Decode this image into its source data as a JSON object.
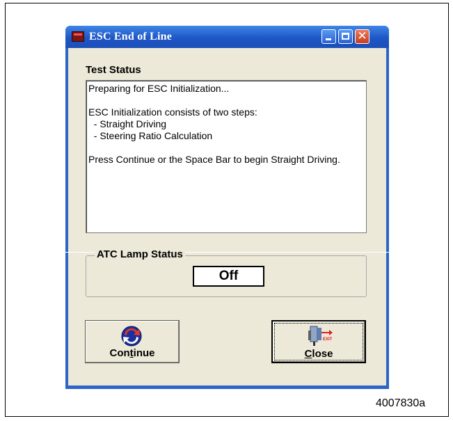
{
  "window": {
    "title": "ESC End of Line",
    "controls": [
      "minimize",
      "maximize",
      "close"
    ],
    "close_glyph": "✕"
  },
  "test_status": {
    "label": "Test Status",
    "lines": [
      "Preparing for ESC Initialization...",
      "",
      "ESC Initialization consists of two steps:",
      "  - Straight Driving",
      "  - Steering Ratio Calculation",
      "",
      "Press Continue or the Space Bar to begin Straight Driving."
    ]
  },
  "atc_lamp": {
    "label": "ATC Lamp Status",
    "value": "Off"
  },
  "buttons": {
    "continue": {
      "label_pre": "Con",
      "label_ul": "t",
      "label_post": "inue",
      "icon": "refresh-icon"
    },
    "close": {
      "label_pre": "",
      "label_ul": "C",
      "label_post": "lose",
      "icon": "exit-icon",
      "icon_text": "EXIT"
    }
  },
  "figure_id": "4007830a",
  "colors": {
    "title_bar": "#2c64c8",
    "dialog_bg": "#ece9d8",
    "close_button": "#d9502c"
  }
}
